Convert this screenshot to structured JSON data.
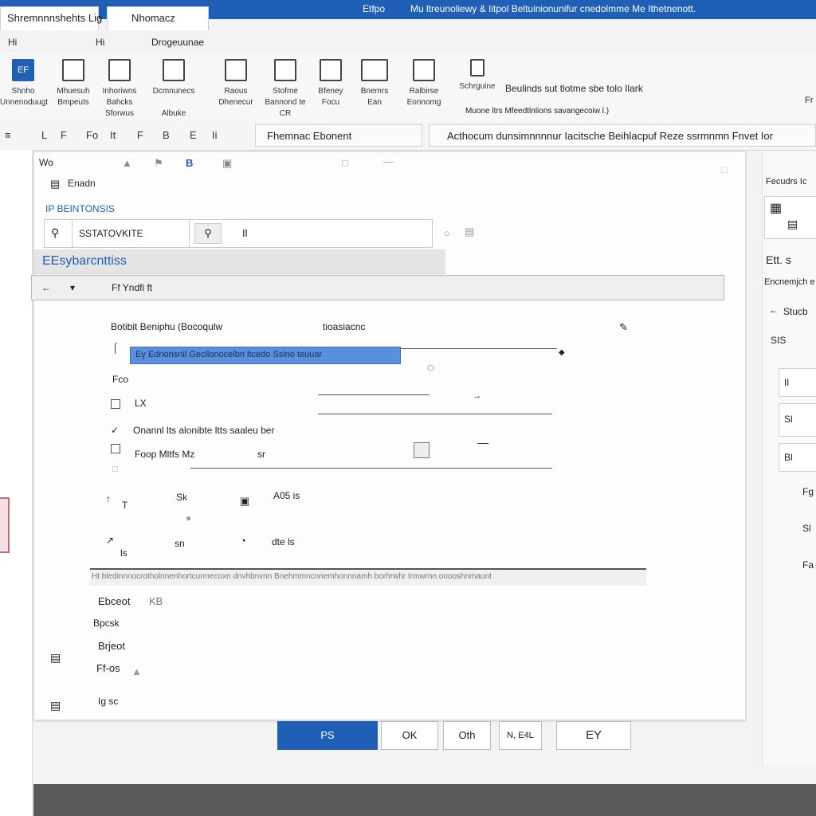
{
  "window": {
    "title_left": "Etfpo",
    "title_right": "Mu ltreunoliewy & Iitpol Beltuinionunifur cnedolmme Me Ithetnenott.",
    "tabs": [
      "Shremnnnshehts Lig",
      "Nhomacz"
    ]
  },
  "ribbon_tabs": [
    "Hi",
    "Hi",
    "Drogeuunae"
  ],
  "ribbon": {
    "buttons": [
      {
        "icon": "selected-app-icon",
        "glyph": "EF",
        "label": "Shnho\nUnnenoduugt"
      },
      {
        "icon": "document-icon",
        "label": "Mhuesuh\nBmpeuts"
      },
      {
        "icon": "pen-tool-icon",
        "label": "Inhoriwns\nBahcks\nSforwus"
      },
      {
        "icon": "folder-icon",
        "label": "Dcmnunecs\n\nAlbuke"
      },
      {
        "icon": "monitor-icon",
        "label": "Raous\nDhenecur"
      },
      {
        "icon": "grid-icon",
        "label": "Stofme\nBannond te\nCR"
      },
      {
        "icon": "brush-icon",
        "label": "Bfeney\nFocu"
      },
      {
        "icon": "table-icon",
        "label": "Bnemrs\nEan"
      },
      {
        "icon": "image-icon",
        "label": "Ralbirse\nEonnomg"
      },
      {
        "icon": "page-icon",
        "label": "Schrguine"
      }
    ],
    "group_line1": "Beulinds sut tlotme sbe tolo   Ilark",
    "group_line2": "Muone   ltrs   Mfeedtlnlions savangecoiw l.)",
    "far_right": "Fr"
  },
  "toolbar": {
    "items": [
      "L",
      "F",
      "Fo",
      "It",
      "F",
      "B",
      "E",
      "Ii"
    ],
    "box_text": "Fhemnac Ebonent",
    "wide_box": "Acthocum dunsimnnnnur  Iacitsche Beihlacpuf Reze ssrmnmn Fnvet Ior"
  },
  "dialog": {
    "toolbar_icons": [
      "Wo",
      "bold-icon",
      "pin-icon",
      "flag-icon",
      "save-icon",
      "tag-icon",
      "bookmark-icon",
      "arrow-icon"
    ],
    "section_title": "Enadn",
    "link_label": "BEINTONSIS",
    "search_field": "SSTATOVKITE",
    "search_suffix": "Il",
    "heading": "EEsybarcnttiss",
    "subheader": "Ff Yndfi ft",
    "row1_label": "Botibit Beniphu (Bocoqulw",
    "row1_note": "tioasiacnc",
    "highlight_text": "Ey Ednonsnil Gecllonocelbn ltcedo Ssino teuuar",
    "label_plain": "Fco",
    "cb1_label": "LX",
    "cb2_label": "Onannl lts alonibte ltts saaleu ber",
    "cb3_label": "Foop Mltfs Mz",
    "cb3_extra": "sr",
    "grid_row1": [
      "T",
      "Sk",
      "A05 is"
    ],
    "grid_row2": [
      "ls",
      "sn",
      "dte ls"
    ],
    "rule_text": "Ht bledinnnocrotholnnenhortcurmecoxn dnvhbnvnn Bnehmmncnnemhonnnamh borhrwhr Irmwrnn ooooshnmaunt",
    "list_items": [
      "Ebceot",
      "Bpcsk",
      "Brjeot",
      "Ff-os",
      "Ig sc"
    ],
    "list_badge": "KB"
  },
  "buttons": [
    "PS",
    "OK",
    "Oth",
    "N, E4L",
    "EY"
  ],
  "right_panel": {
    "header": "Fecudrs  Ic",
    "label1": "Ett. s",
    "label2": "Encnemjch e",
    "label3": "Stucb",
    "label4": "SIS",
    "row1": "Il",
    "row2": "Sl",
    "row3": "Bl",
    "foot1": "Fg",
    "foot2": "Sl",
    "foot3": "Fa"
  }
}
